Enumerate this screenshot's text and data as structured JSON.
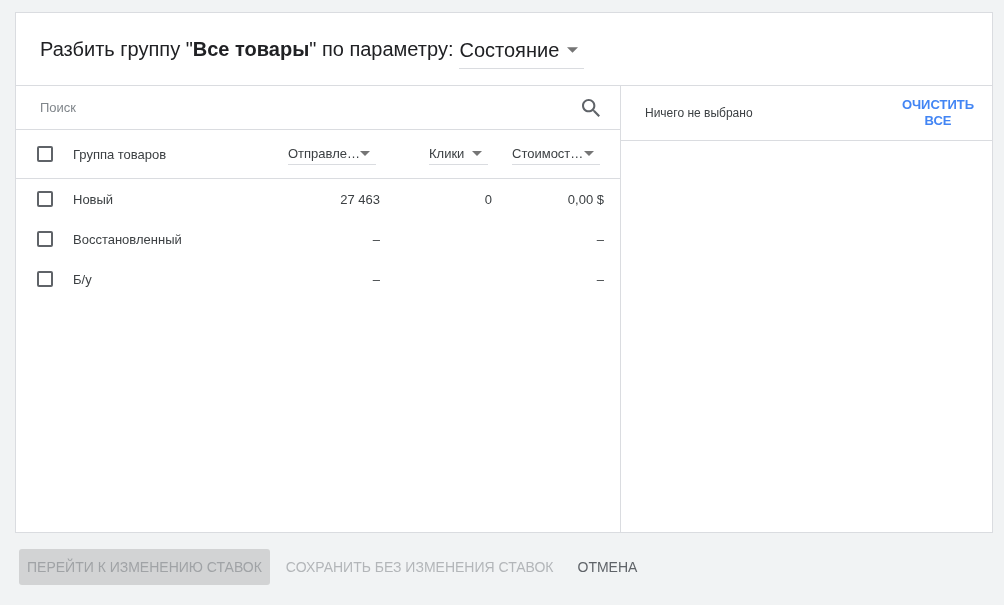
{
  "dialog": {
    "title": "Разбить группу \"**Все товары**\" по параметру:",
    "parameter_dropdown": {
      "value": "Состояние"
    }
  },
  "search": {
    "placeholder": "Поиск"
  },
  "table": {
    "select_all": {
      "checked": false
    },
    "columns": [
      {
        "label": "Группа товаров",
        "kind": "text"
      },
      {
        "label": "Отправле…",
        "kind": "sort"
      },
      {
        "label": "Клики",
        "kind": "sort"
      },
      {
        "label": "Стоимост…",
        "kind": "sort"
      }
    ],
    "rows": [
      {
        "checked": false,
        "cells": [
          "Новый",
          "27 463",
          "0",
          "0,00 $"
        ]
      },
      {
        "checked": false,
        "cells": [
          "Восстановленный",
          "–",
          null,
          "–"
        ]
      },
      {
        "checked": false,
        "cells": [
          "Б/у",
          "–",
          null,
          "–"
        ]
      }
    ]
  },
  "selection_panel": {
    "status": "Ничего не выбрано",
    "clear_button": "ОЧИСТИТЬ ВСЕ"
  },
  "footer_buttons": [
    {
      "label": "ПЕРЕЙТИ К ИЗМЕНЕНИЮ СТАВОК",
      "kind": "filled",
      "disabled": true
    },
    {
      "label": "СОХРАНИТЬ БЕЗ ИЗМЕНЕНИЯ СТАВОК",
      "kind": "text",
      "disabled": true
    },
    {
      "label": "ОТМЕНА",
      "kind": "text",
      "disabled": false
    }
  ]
}
